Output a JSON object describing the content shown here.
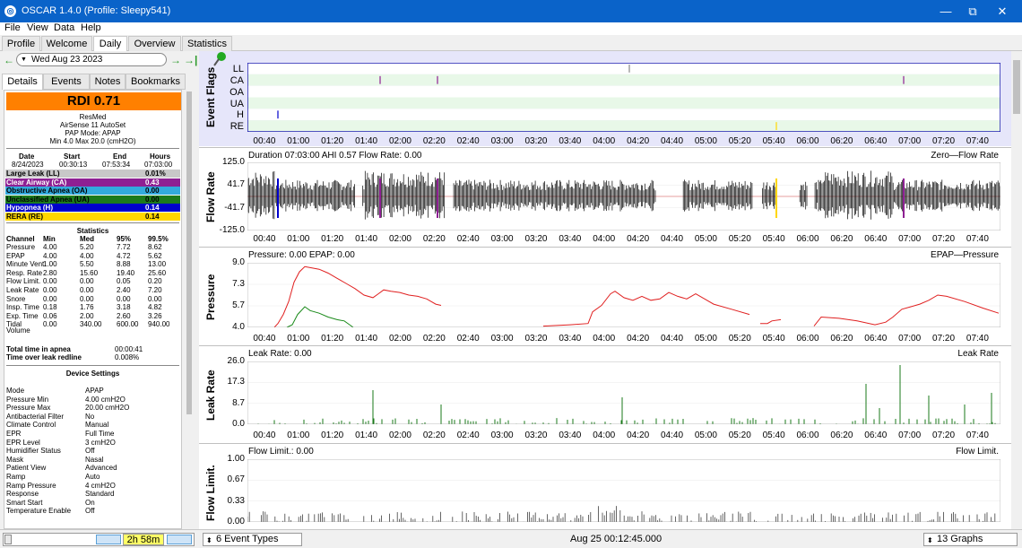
{
  "window": {
    "title": "OSCAR 1.4.0 (Profile: Sleepy541)",
    "minimize": "—",
    "restore": "⧉",
    "close": "✕"
  },
  "menu": [
    "File",
    "View",
    "Data",
    "Help"
  ],
  "tabs": [
    "Profile",
    "Welcome",
    "Daily",
    "Overview",
    "Statistics"
  ],
  "date_selector": {
    "value": "Wed Aug 23 2023",
    "prev": "←",
    "next": "→",
    "last": "→|"
  },
  "left_tabs": [
    "Details",
    "Events",
    "Notes",
    "Bookmarks"
  ],
  "summary": {
    "rdi": "RDI 0.71",
    "brand": "ResMed",
    "model": "AirSense 11 AutoSet",
    "pap_mode": "PAP Mode: APAP",
    "pressure_range": "Min 4.0 Max 20.0 (cmH2O)",
    "session_headers": [
      "Date",
      "Start",
      "End",
      "Hours"
    ],
    "session_values": [
      "8/24/2023",
      "00:30:13",
      "07:53:34",
      "07:03:00"
    ]
  },
  "events": [
    {
      "label": "Large Leak (LL)",
      "value": "0.01%",
      "color": "#c8c8c8",
      "text_color": "#000000"
    },
    {
      "label": "Clear Airway (CA)",
      "value": "0.43",
      "color": "#8e2093",
      "text_color": "#ffffff"
    },
    {
      "label": "Obstructive Apnea (OA)",
      "value": "0.00",
      "color": "#33aadd",
      "text_color": "#000000"
    },
    {
      "label": "Unclassified Apnea (UA)",
      "value": "0.00",
      "color": "#1c7a1c",
      "text_color": "#000000"
    },
    {
      "label": "Hypopnea (H)",
      "value": "0.14",
      "color": "#0000cc",
      "text_color": "#ffffff"
    },
    {
      "label": "RERA (RE)",
      "value": "0.14",
      "color": "#ffd700",
      "text_color": "#000000"
    }
  ],
  "statistics": {
    "title": "Statistics",
    "headers": [
      "Channel",
      "Min",
      "Med",
      "95%",
      "99.5%"
    ],
    "rows": [
      [
        "Pressure",
        "4.00",
        "5.20",
        "7.72",
        "8.62"
      ],
      [
        "EPAP",
        "4.00",
        "4.00",
        "4.72",
        "5.62"
      ],
      [
        "Minute Vent.",
        "1.00",
        "5.50",
        "8.88",
        "13.00"
      ],
      [
        "Resp. Rate",
        "2.80",
        "15.60",
        "19.40",
        "25.60"
      ],
      [
        "Flow Limit.",
        "0.00",
        "0.00",
        "0.05",
        "0.20"
      ],
      [
        "Leak Rate",
        "0.00",
        "0.00",
        "2.40",
        "7.20"
      ],
      [
        "Snore",
        "0.00",
        "0.00",
        "0.00",
        "0.00"
      ],
      [
        "Insp. Time",
        "0.18",
        "1.76",
        "3.18",
        "4.82"
      ],
      [
        "Exp. Time",
        "0.06",
        "2.00",
        "2.60",
        "3.26"
      ],
      [
        "Tidal",
        "0.00",
        "340.00",
        "600.00",
        "940.00"
      ]
    ],
    "tidal_unit": "Volume",
    "apnea_label": "Total time in apnea",
    "apnea_value": "00:00:41",
    "leak_label": "Time over leak redline",
    "leak_value": "0.008%"
  },
  "device_settings": {
    "title": "Device Settings",
    "rows": [
      [
        "Mode",
        "APAP"
      ],
      [
        "Pressure Min",
        "4.00 cmH2O"
      ],
      [
        "Pressure Max",
        "20.00 cmH2O"
      ],
      [
        "Antibacterial Filter",
        "No"
      ],
      [
        "Climate Control",
        "Manual"
      ],
      [
        "EPR",
        "Full Time"
      ],
      [
        "EPR Level",
        "3 cmH2O"
      ],
      [
        "Humidifier Status",
        "Off"
      ],
      [
        "Mask",
        "Nasal"
      ],
      [
        "Patient View",
        "Advanced"
      ],
      [
        "Ramp",
        "Auto"
      ],
      [
        "Ramp Pressure",
        "4 cmH2O"
      ],
      [
        "Response",
        "Standard"
      ],
      [
        "Smart Start",
        "On"
      ],
      [
        "Temperature Enable",
        "Off"
      ]
    ]
  },
  "x_ticks": [
    "00:40",
    "01:00",
    "01:20",
    "01:40",
    "02:00",
    "02:20",
    "02:40",
    "03:00",
    "03:20",
    "03:40",
    "04:00",
    "04:20",
    "04:40",
    "05:00",
    "05:20",
    "05:40",
    "06:00",
    "06:20",
    "06:40",
    "07:00",
    "07:20",
    "07:40"
  ],
  "graphs": {
    "event_flags": {
      "ylabel": "Event Flags",
      "rows": [
        "LL",
        "CA",
        "OA",
        "UA",
        "H",
        "RE"
      ],
      "pin_icon": "pushpin-icon"
    },
    "flow_rate": {
      "ylabel": "Flow Rate",
      "title": "Duration 07:03:00 AHI 0.57 Flow Rate: 0.00",
      "legend": "Zero—Flow Rate",
      "yticks": [
        "125.0",
        "41.7",
        "-41.7",
        "-125.0"
      ]
    },
    "pressure": {
      "ylabel": "Pressure",
      "title": "Pressure: 0.00 EPAP: 0.00",
      "legend": "EPAP—Pressure",
      "yticks": [
        "9.0",
        "7.3",
        "5.7",
        "4.0"
      ]
    },
    "leak_rate": {
      "ylabel": "Leak Rate",
      "title": "Leak Rate: 0.00",
      "legend": "Leak Rate",
      "yticks": [
        "26.0",
        "17.3",
        "8.7",
        "0.0"
      ]
    },
    "flow_limit": {
      "ylabel": "Flow Limit.",
      "title": "Flow Limit.: 0.00",
      "legend": "Flow Limit.",
      "yticks": [
        "1.00",
        "0.67",
        "0.33",
        "0.00"
      ]
    }
  },
  "status": {
    "duration": "2h 58m",
    "event_types": "6 Event Types",
    "timestamp": "Aug 25 00:12:45.000",
    "graphs": "13 Graphs"
  },
  "colors": {
    "titlebar": "#0a63c9",
    "rdi": "#ff8000",
    "pressure": "#e02020",
    "epap": "#1a8a1a",
    "leak": "#1a7a1a",
    "flowlimit": "#404040",
    "flag_bg": "#e8f8e8",
    "flag_border": "#1a1ab0"
  }
}
